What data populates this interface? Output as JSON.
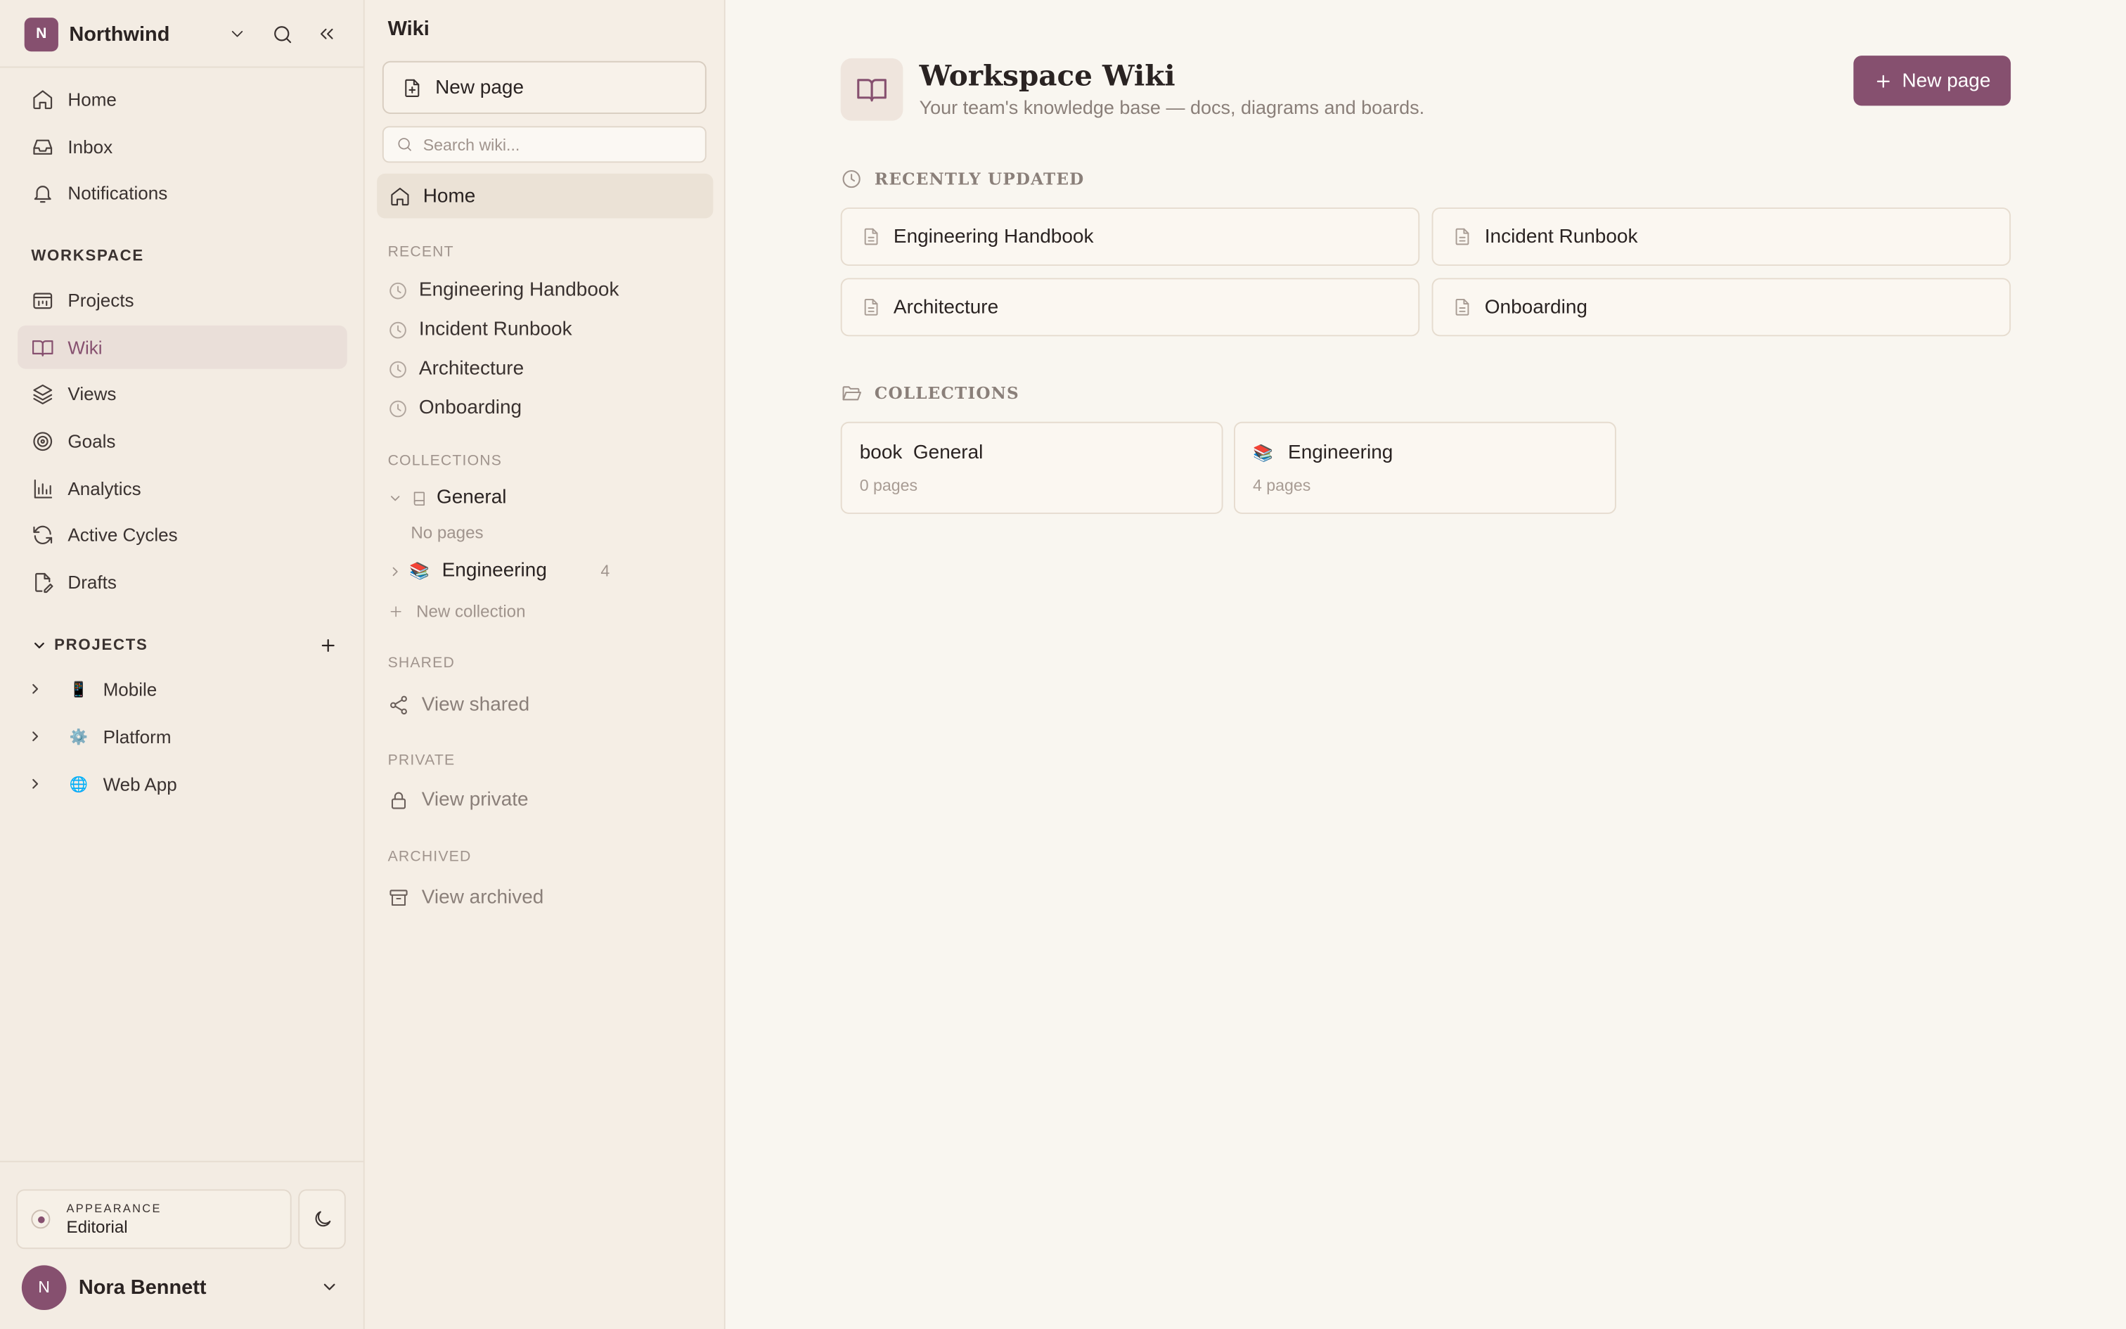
{
  "workspace": {
    "initial": "N",
    "name": "Northwind"
  },
  "nav": {
    "home": "Home",
    "inbox": "Inbox",
    "notifications": "Notifications",
    "workspace_label": "WORKSPACE",
    "projects": "Projects",
    "wiki": "Wiki",
    "views": "Views",
    "goals": "Goals",
    "analytics": "Analytics",
    "active_cycles": "Active Cycles",
    "drafts": "Drafts"
  },
  "projects": {
    "label": "PROJECTS",
    "items": [
      {
        "emoji": "📱",
        "name": "Mobile"
      },
      {
        "emoji": "⚙️",
        "name": "Platform"
      },
      {
        "emoji": "🌐",
        "name": "Web App"
      }
    ]
  },
  "appearance": {
    "label": "APPEARANCE",
    "value": "Editorial"
  },
  "user": {
    "initial": "N",
    "name": "Nora Bennett"
  },
  "panel": {
    "title": "Wiki",
    "new_page": "New page",
    "search_placeholder": "Search wiki...",
    "home": "Home",
    "recent_label": "RECENT",
    "recent": [
      "Engineering Handbook",
      "Incident Runbook",
      "Architecture",
      "Onboarding"
    ],
    "collections_label": "COLLECTIONS",
    "collections": [
      {
        "name": "General",
        "empty_text": "No pages"
      },
      {
        "emoji": "📚",
        "name": "Engineering",
        "count": "4"
      }
    ],
    "new_collection": "New collection",
    "shared_label": "SHARED",
    "view_shared": "View shared",
    "private_label": "PRIVATE",
    "view_private": "View private",
    "archived_label": "ARCHIVED",
    "view_archived": "View archived"
  },
  "main": {
    "title": "Workspace Wiki",
    "subtitle": "Your team's knowledge base — docs, diagrams and boards.",
    "new_page": "New page",
    "recent_label": "RECENTLY UPDATED",
    "recent": [
      "Engineering Handbook",
      "Incident Runbook",
      "Architecture",
      "Onboarding"
    ],
    "collections_label": "COLLECTIONS",
    "collections": [
      {
        "name": "book  General",
        "count": "0 pages"
      },
      {
        "emoji": "📚",
        "name": "Engineering",
        "count": "4 pages"
      }
    ]
  },
  "colors": {
    "accent": "#86506f",
    "background": "#f9f6f0",
    "sidebar": "#f3ece3"
  }
}
